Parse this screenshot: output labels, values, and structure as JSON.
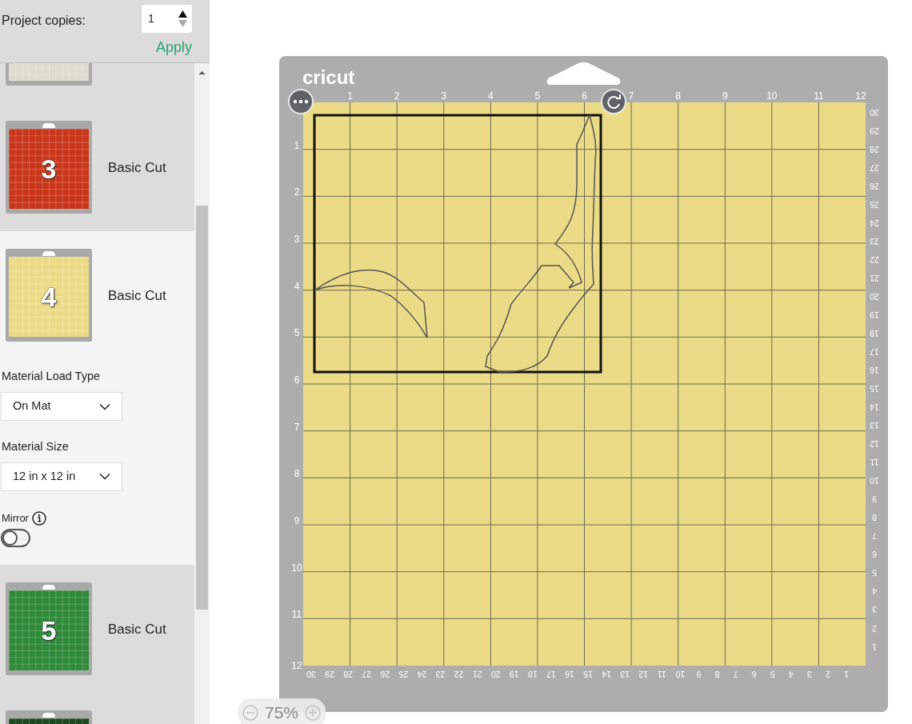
{
  "copies": {
    "label": "Project copies:",
    "value": "1",
    "apply": "Apply"
  },
  "mats": [
    {
      "kind": "cut-top",
      "color": "#dedccf",
      "selected": false
    },
    {
      "kind": "full",
      "number": "3",
      "label": "Basic Cut",
      "color": "#c9361a",
      "selected": false
    },
    {
      "kind": "full",
      "number": "4",
      "label": "Basic Cut",
      "color": "#ecdb86",
      "selected": true,
      "settings": {
        "load_type": {
          "label": "Material Load Type",
          "value": "On Mat"
        },
        "size": {
          "label": "Material Size",
          "value": "12 in x 12 in"
        },
        "mirror": {
          "label": "Mirror",
          "on": false
        }
      }
    },
    {
      "kind": "full",
      "number": "5",
      "label": "Basic Cut",
      "color": "#2f8a3a",
      "selected": false
    },
    {
      "kind": "cut-bottom",
      "color": "#1c4a20",
      "selected": false
    }
  ],
  "mat_canvas": {
    "brand": "cricut",
    "top_ruler": [
      "1",
      "2",
      "3",
      "4",
      "5",
      "6",
      "7",
      "8",
      "9",
      "10",
      "11",
      "12"
    ],
    "left_ruler": [
      "1",
      "2",
      "3",
      "4",
      "5",
      "6",
      "7",
      "8",
      "9",
      "10",
      "11",
      "12"
    ],
    "right_ruler": [
      "30",
      "29",
      "28",
      "27",
      "26",
      "25",
      "24",
      "23",
      "22",
      "21",
      "20",
      "19",
      "18",
      "17",
      "16",
      "15",
      "14",
      "13",
      "12",
      "11",
      "10",
      "9",
      "8",
      "7",
      "6",
      "5",
      "4",
      "3",
      "2",
      "1"
    ],
    "bottom_ruler": [
      "30",
      "29",
      "28",
      "27",
      "26",
      "25",
      "24",
      "23",
      "22",
      "21",
      "20",
      "19",
      "18",
      "17",
      "16",
      "15",
      "14",
      "13",
      "12",
      "11",
      "10",
      "9",
      "8",
      "7",
      "6",
      "5",
      "4",
      "3",
      "2",
      "1"
    ]
  },
  "zoom": {
    "value": "75%"
  }
}
